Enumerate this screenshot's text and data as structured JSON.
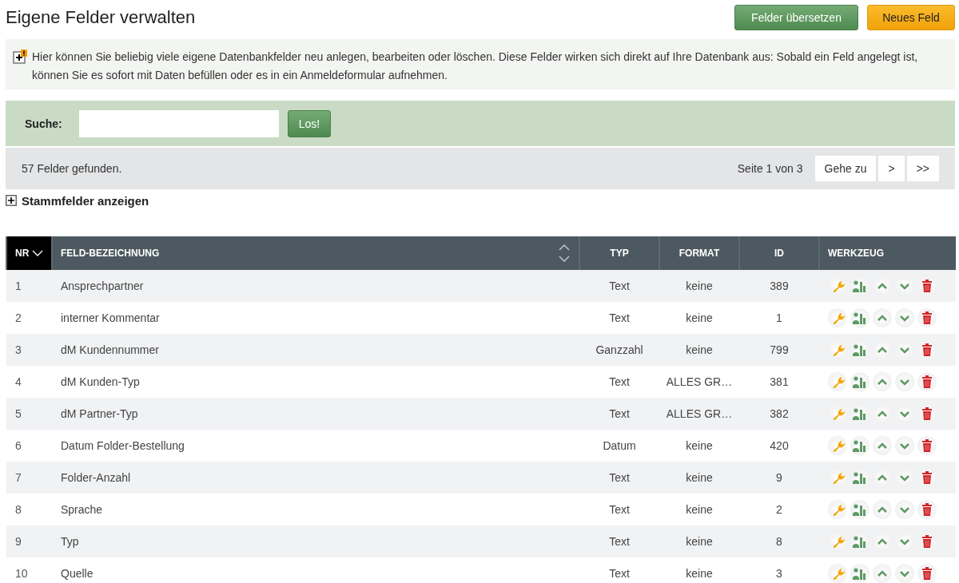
{
  "page": {
    "title": "Eigene Felder verwalten"
  },
  "header_buttons": [
    {
      "label": "Felder übersetzen",
      "kind": "secondary"
    },
    {
      "label": "Neues Feld",
      "kind": "primary"
    }
  ],
  "info": {
    "text": "Hier können Sie beliebig viele eigene Datenbankfelder neu anlegen, bearbeiten oder löschen. Diese Felder wirken sich direkt auf Ihre Datenbank aus: Sobald ein Feld angelegt ist, können Sie es sofort mit Daten befüllen oder es in ein Anmeldeformular aufnehmen."
  },
  "search": {
    "label": "Suche:",
    "button": "Los!"
  },
  "results": {
    "count": "57 Felder gefunden.",
    "page_info": "Seite 1 von 3",
    "goto": "Gehe zu",
    "next": ">",
    "last": ">>"
  },
  "toggle": {
    "label": "Stammfelder anzeigen",
    "expanded": false
  },
  "table": {
    "columns": [
      {
        "label": "NR",
        "sorted": true,
        "sortable": true
      },
      {
        "label": "FELD-BEZEICHNUNG",
        "sorted": false,
        "sortable": true
      },
      {
        "label": "TYP",
        "sorted": false,
        "sortable": false
      },
      {
        "label": "FORMAT",
        "sorted": false,
        "sortable": false
      },
      {
        "label": "ID",
        "sorted": false,
        "sortable": false
      },
      {
        "label": "WERKZEUG",
        "sorted": false,
        "sortable": false
      }
    ],
    "rows": [
      [
        "1",
        "Ansprechpartner",
        "Text",
        "keine",
        "389"
      ],
      [
        "2",
        "interner Kommentar",
        "Text",
        "keine",
        "1"
      ],
      [
        "3",
        "dM Kundennummer",
        "Ganzzahl",
        "keine",
        "799"
      ],
      [
        "4",
        "dM Kunden-Typ",
        "Text",
        "ALLES GR…",
        "381"
      ],
      [
        "5",
        "dM Partner-Typ",
        "Text",
        "ALLES GR…",
        "382"
      ],
      [
        "6",
        "Datum Folder-Bestellung",
        "Datum",
        "keine",
        "420"
      ],
      [
        "7",
        "Folder-Anzahl",
        "Text",
        "keine",
        "9"
      ],
      [
        "8",
        "Sprache",
        "Text",
        "keine",
        "2"
      ],
      [
        "9",
        "Typ",
        "Text",
        "keine",
        "8"
      ],
      [
        "10",
        "Quelle",
        "Text",
        "keine",
        "3"
      ]
    ]
  }
}
